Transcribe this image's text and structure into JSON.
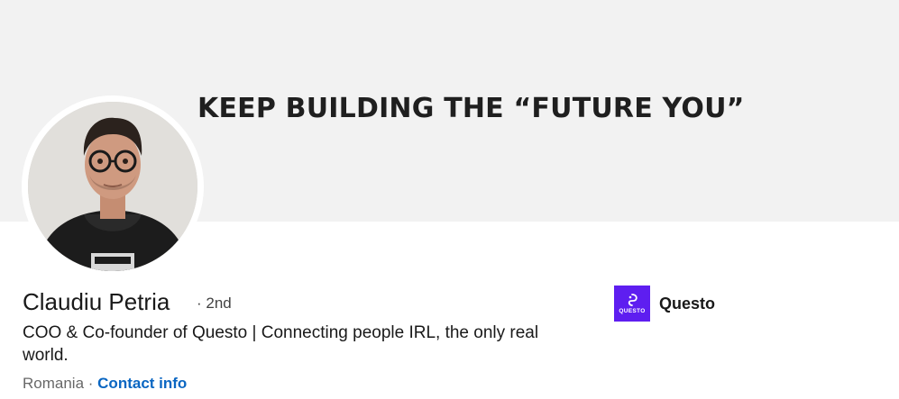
{
  "banner": {
    "text": "KEEP BUILDING THE “FUTURE YOU”",
    "background_color": "#f2f2f2"
  },
  "profile": {
    "name": "Claudiu Petria",
    "degree": "· 2nd",
    "headline": "COO & Co-founder of Questo | Connecting people IRL, the only real world.",
    "location": "Romania",
    "separator": " · ",
    "contact_info_label": "Contact info"
  },
  "company": {
    "name": "Questo",
    "logo_text": "QUESTO",
    "logo_color": "#5e1ef0"
  },
  "colors": {
    "link": "#0a66c2"
  }
}
